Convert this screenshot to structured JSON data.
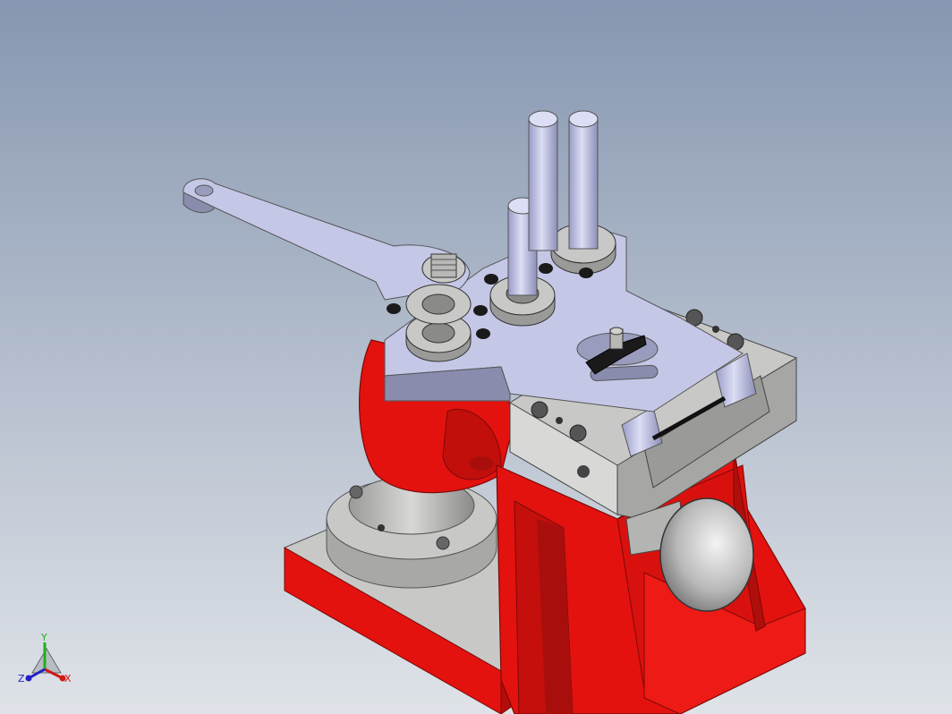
{
  "view": {
    "background_top": "#8797b1",
    "background_bottom": "#dfe3e8"
  },
  "model": {
    "name": "pipe-bender-assembly",
    "colors": {
      "red_body": "#e3120f",
      "red_dark": "#a80f0c",
      "grey_plate": "#c8c8c6",
      "grey_plate_dark": "#8e8e8c",
      "lavender": "#c5c7e6",
      "lavender_dark": "#8a8cae",
      "black_handle": "#1a1a1a"
    }
  },
  "triad": {
    "x_label": "X",
    "y_label": "Y",
    "z_label": "Z",
    "x_color": "#d01818",
    "y_color": "#1eb01e",
    "z_color": "#2020c8"
  }
}
